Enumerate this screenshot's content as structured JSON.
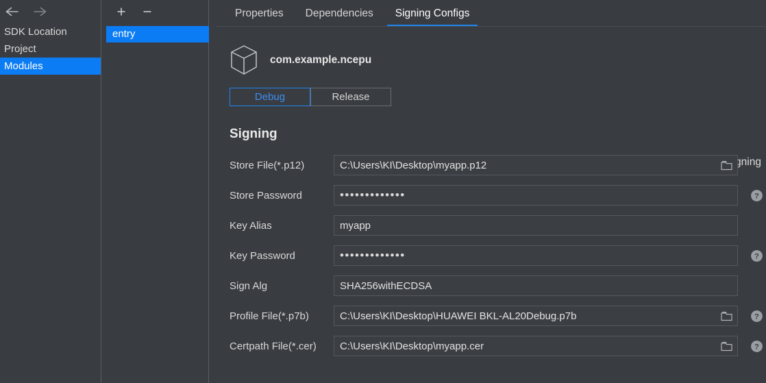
{
  "nav": {
    "back_icon": "arrow-left-icon",
    "forward_icon": "arrow-right-icon",
    "items": [
      {
        "label": "SDK Location",
        "selected": false
      },
      {
        "label": "Project",
        "selected": false
      },
      {
        "label": "Modules",
        "selected": true
      }
    ]
  },
  "modules": {
    "add_label": "+",
    "remove_label": "−",
    "items": [
      {
        "label": "entry",
        "selected": true
      }
    ]
  },
  "tabs": [
    {
      "label": "Properties",
      "active": false
    },
    {
      "label": "Dependencies",
      "active": false
    },
    {
      "label": "Signing Configs",
      "active": true
    }
  ],
  "package": {
    "icon": "module-cube-icon",
    "name": "com.example.ncepu"
  },
  "build_variant": {
    "options": [
      {
        "label": "Debug",
        "active": true
      },
      {
        "label": "Release",
        "active": false
      }
    ]
  },
  "auto_generate": {
    "label": "Automatically generate signing",
    "checked": false
  },
  "signing": {
    "title": "Signing",
    "fields": [
      {
        "label": "Store File(*.p12)",
        "value": "C:\\Users\\KI\\Desktop\\myapp.p12",
        "type": "text",
        "browse": true,
        "help": false
      },
      {
        "label": "Store Password",
        "value": "•••••••••••••",
        "type": "password",
        "browse": false,
        "help": true
      },
      {
        "label": "Key Alias",
        "value": "myapp",
        "type": "text",
        "browse": false,
        "help": false
      },
      {
        "label": "Key Password",
        "value": "•••••••••••••",
        "type": "password",
        "browse": false,
        "help": true
      },
      {
        "label": "Sign Alg",
        "value": "SHA256withECDSA",
        "type": "text",
        "browse": false,
        "help": false
      },
      {
        "label": "Profile File(*.p7b)",
        "value": "C:\\Users\\KI\\Desktop\\HUAWEI BKL-AL20Debug.p7b",
        "type": "text",
        "browse": true,
        "help": true
      },
      {
        "label": "Certpath File(*.cer)",
        "value": "C:\\Users\\KI\\Desktop\\myapp.cer",
        "type": "text",
        "browse": true,
        "help": true
      }
    ]
  },
  "colors": {
    "background": "#393c41",
    "accent_blue": "#0c7cf5",
    "tab_indicator": "#1e86ee",
    "border": "#55585e",
    "text": "#d8d8d8"
  }
}
